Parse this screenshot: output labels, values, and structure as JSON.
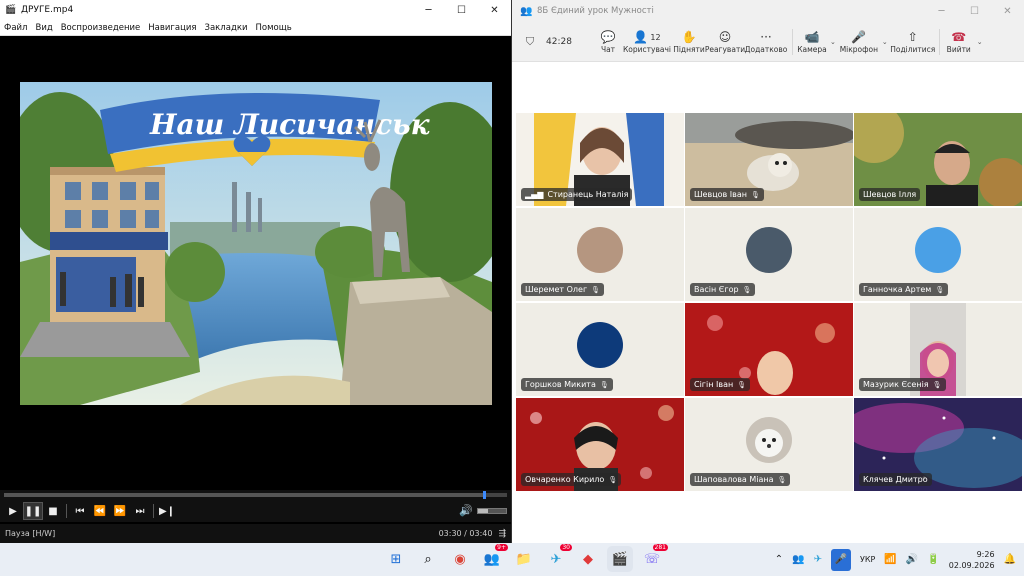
{
  "media_player": {
    "title": "ДРУГЕ.mp4",
    "menu": [
      "Файл",
      "Вид",
      "Воспроизведение",
      "Навигация",
      "Закладки",
      "Помощь"
    ],
    "video_text": "Наш Лисичанськ",
    "status_left": "Пауза [H/W]",
    "time": "03:30 / 03:40",
    "progress": 0.955,
    "volume": 0.35
  },
  "meeting": {
    "title": "8Б Єдиний урок Мужності",
    "timer": "42:28",
    "toolbar": {
      "chat": "Чат",
      "people": "Користувачі",
      "people_count": "12",
      "raise": "Підняти",
      "react": "Реагувати",
      "more": "Додатково",
      "camera": "Камера",
      "mic": "Мікрофон",
      "share": "Поділитися",
      "leave": "Вийти"
    },
    "participants": [
      {
        "name": "Стиранець Наталія"
      },
      {
        "name": "Шевцов Іван"
      },
      {
        "name": "Шевцов Ілля"
      },
      {
        "name": "Шеремет Олег"
      },
      {
        "name": "Васін Єгор"
      },
      {
        "name": "Ганночка Артем"
      },
      {
        "name": "Горшков Микита"
      },
      {
        "name": "Сігін Іван"
      },
      {
        "name": "Мазурик Єсенія"
      },
      {
        "name": "Овчаренко Кирило"
      },
      {
        "name": "Шаповалова Міана"
      },
      {
        "name": "Клячев Дмитро"
      }
    ]
  },
  "taskbar": {
    "badges": {
      "teams": "9+",
      "telegram": "30",
      "viber": "281"
    },
    "lang": "УКР",
    "time": "9:26",
    "date": "02.09.2026"
  },
  "colors": {
    "accent": "#3d8bfd",
    "teams": "#6264a7",
    "leave": "#c4314b"
  }
}
